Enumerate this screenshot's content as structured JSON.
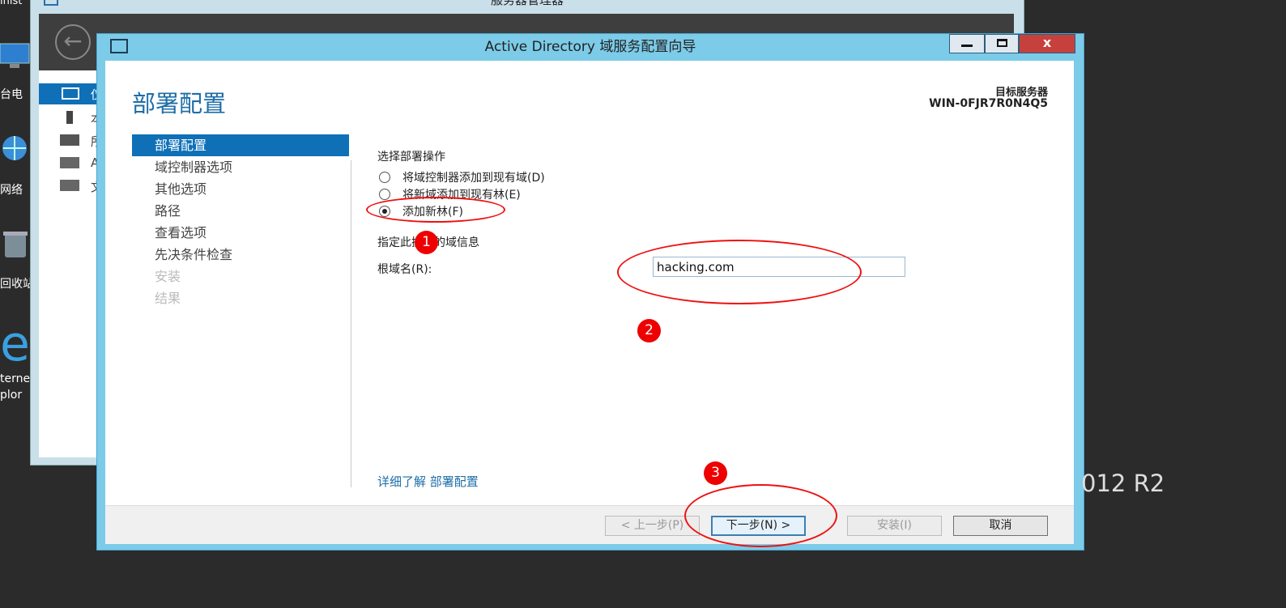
{
  "desktop": {
    "icons": [
      {
        "label": "台电",
        "icon": "computer-icon"
      },
      {
        "label": "网络",
        "icon": "network-icon"
      },
      {
        "label": "回收站",
        "icon": "recycle-bin-icon"
      },
      {
        "label": "terne\nplor",
        "icon": "internet-explorer-icon"
      }
    ],
    "edition_text": "012 R2",
    "partial_label": "inist"
  },
  "server_manager": {
    "title": "服务器管理器",
    "nav_glyphs": [
      "仪",
      "本",
      "所",
      "A",
      "文"
    ]
  },
  "wizard": {
    "title": "Active Directory 域服务配置向导",
    "heading": "部署配置",
    "target_label": "目标服务器",
    "target_name": "WIN-0FJR7R0N4Q5",
    "nav": [
      {
        "label": "部署配置",
        "state": "active"
      },
      {
        "label": "域控制器选项",
        "state": "normal"
      },
      {
        "label": "其他选项",
        "state": "normal"
      },
      {
        "label": "路径",
        "state": "normal"
      },
      {
        "label": "查看选项",
        "state": "normal"
      },
      {
        "label": "先决条件检查",
        "state": "normal"
      },
      {
        "label": "安装",
        "state": "disabled"
      },
      {
        "label": "结果",
        "state": "disabled"
      }
    ],
    "operation_heading": "选择部署操作",
    "options": [
      {
        "label": "将域控制器添加到现有域(D)",
        "selected": false
      },
      {
        "label": "将新域添加到现有林(E)",
        "selected": false
      },
      {
        "label": "添加新林(F)",
        "selected": true
      }
    ],
    "domain_info_heading": "指定此操作的域信息",
    "root_domain_label": "根域名(R):",
    "root_domain_value": "hacking.com",
    "learn_more": "详细了解 部署配置",
    "buttons": {
      "back": "< 上一步(P)",
      "next": "下一步(N) >",
      "install": "安装(I)",
      "cancel": "取消"
    }
  },
  "annotations": {
    "markers": [
      "1",
      "2",
      "3"
    ],
    "color": "#ee1111"
  }
}
